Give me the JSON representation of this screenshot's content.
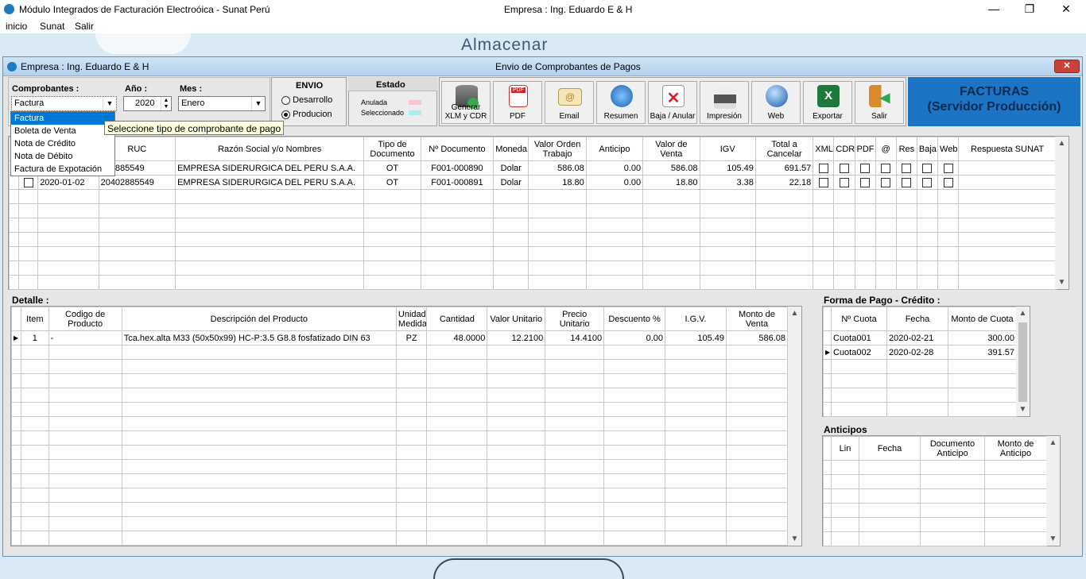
{
  "window": {
    "title": "Módulo Integrados de Facturación Electroóica - Sunat Perú",
    "company": "Empresa : Ing. Eduardo E & H"
  },
  "menu": [
    "inicio",
    "Sunat",
    "Salir"
  ],
  "background_label": "Almacenar",
  "child_window": {
    "left_title": "Empresa : Ing. Eduardo E & H",
    "center_title": "Envio de Comprobantes de Pagos",
    "close": "✕"
  },
  "filters": {
    "comprobantes_label": "Comprobantes :",
    "comprobantes_value": "Factura",
    "anio_label": "Año :",
    "anio_value": "2020",
    "mes_label": "Mes :",
    "mes_value": "Enero",
    "dropdown_options": [
      "Factura",
      "Boleta de Venta",
      "Nota de Crédito",
      "Nota de Débito",
      "Factura de Expotación"
    ],
    "tooltip": "Seleccione tipo de comprobante de pago"
  },
  "envio": {
    "label": "ENVIO",
    "options": [
      "Desarrollo",
      "Producion"
    ],
    "selected": "Producion"
  },
  "estado": {
    "label": "Estado",
    "items": [
      {
        "name": "Anulada",
        "color": "#f9c6cc"
      },
      {
        "name": "Seleccionado",
        "color": "#a8f0f0"
      }
    ]
  },
  "toolbar": [
    {
      "label": "Generar XLM y CDR",
      "icon": "database-icon"
    },
    {
      "label": "PDF",
      "icon": "pdf-icon"
    },
    {
      "label": "Email",
      "icon": "email-icon"
    },
    {
      "label": "Resumen",
      "icon": "resumen-icon"
    },
    {
      "label": "Baja / Anular",
      "icon": "cancel-document-icon"
    },
    {
      "label": "Impresión",
      "icon": "printer-icon"
    },
    {
      "label": "Web",
      "icon": "globe-icon"
    },
    {
      "label": "Exportar",
      "icon": "excel-icon"
    },
    {
      "label": "Salir",
      "icon": "exit-icon"
    }
  ],
  "panel": {
    "title": "FACTURAS",
    "subtitle": "(Servidor Producción)"
  },
  "docs": {
    "headers": [
      "RUC",
      "Razón Social y/o Nombres",
      "Tipo de Documento",
      "Nº Documento",
      "Moneda",
      "Valor Orden Trabajo",
      "Anticipo",
      "Valor de Venta",
      "IGV",
      "Total a Cancelar",
      "XML",
      "CDR",
      "PDF",
      "@",
      "Res",
      "Baja",
      "Web",
      "Respuesta SUNAT"
    ],
    "rows": [
      {
        "fecha": "",
        "ruc": "20402885549",
        "ruc_visible": "402885549",
        "razon": "EMPRESA SIDERURGICA DEL PERU S.A.A.",
        "tipo": "OT",
        "doc": "F001-000890",
        "moneda": "Dolar",
        "vot": "586.08",
        "anticipo": "0.00",
        "vventa": "586.08",
        "igv": "105.49",
        "total": "691.57"
      },
      {
        "fecha": "2020-01-02",
        "ruc": "20402885549",
        "ruc_visible": "20402885549",
        "razon": "EMPRESA SIDERURGICA DEL PERU S.A.A.",
        "tipo": "OT",
        "doc": "F001-000891",
        "moneda": "Dolar",
        "vot": "18.80",
        "anticipo": "0.00",
        "vventa": "18.80",
        "igv": "3.38",
        "total": "22.18"
      }
    ]
  },
  "detalle": {
    "label": "Detalle :",
    "headers": [
      "Item",
      "Codigo de Producto",
      "Descripción del Producto",
      "Unidad Medida",
      "Cantidad",
      "Valor Unitario",
      "Precio Unitario",
      "Descuento %",
      "I.G.V.",
      "Monto de Venta"
    ],
    "rows": [
      {
        "item": "1",
        "codigo": "-",
        "desc": "Tca.hex.alta M33 (50x50x99) HC-P:3.5 G8.8 fosfatizado DIN 63",
        "unidad": "PZ",
        "cantidad": "48.0000",
        "vunit": "12.2100",
        "punit": "14.4100",
        "desc_pct": "0.00",
        "igv": "105.49",
        "monto": "586.08"
      }
    ]
  },
  "forma_pago": {
    "label": "Forma de Pago - Crédito :",
    "headers": [
      "Nº Cuota",
      "Fecha",
      "Monto de Cuota"
    ],
    "rows": [
      {
        "cuota": "Cuota001",
        "fecha": "2020-02-21",
        "monto": "300.00"
      },
      {
        "cuota": "Cuota002",
        "fecha": "2020-02-28",
        "monto": "391.57"
      }
    ]
  },
  "anticipos": {
    "label": "Anticipos",
    "headers": [
      "Lin",
      "Fecha",
      "Documento Anticipo",
      "Monto de Anticipo"
    ]
  },
  "colors": {
    "accent": "#1d74c4",
    "selection": "#0078d7",
    "title_bar": "#cfe4f6",
    "close": "#c9423a"
  }
}
